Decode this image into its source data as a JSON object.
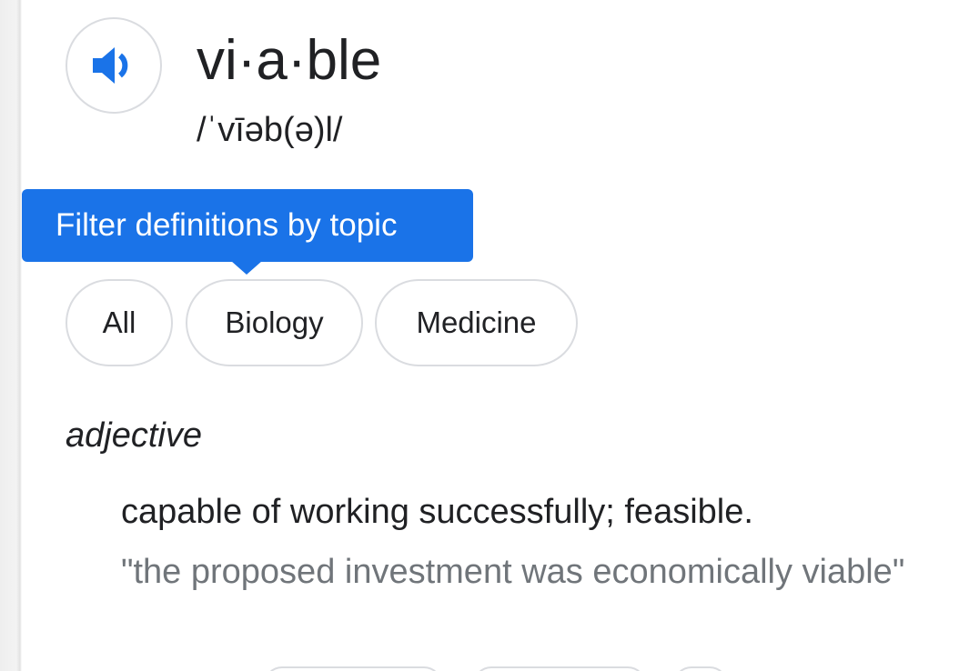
{
  "entry": {
    "headword": "vi·a·ble",
    "phonetic": "/ˈvīəb(ə)l/",
    "audio_icon": "speaker-icon"
  },
  "filter_tooltip": {
    "text": "Filter definitions by topic",
    "background_color": "#1a73e8"
  },
  "topic_chips": [
    {
      "label": "All"
    },
    {
      "label": "Biology"
    },
    {
      "label": "Medicine"
    }
  ],
  "sense": {
    "part_of_speech": "adjective",
    "definition": "capable of working successfully; feasible.",
    "example": "\"the proposed investment was economically viable\""
  },
  "colors": {
    "accent_blue": "#1a73e8",
    "text_primary": "#202124",
    "text_secondary": "#70757a",
    "chip_border": "#dadce0"
  }
}
